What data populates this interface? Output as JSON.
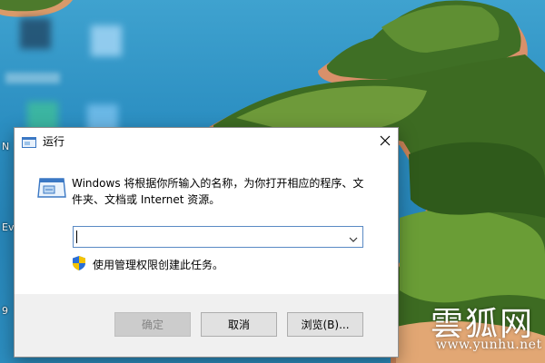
{
  "desktop": {
    "edge_labels": [
      "N",
      "Ev",
      "9"
    ],
    "watermark": {
      "chinese": "雲狐网",
      "url": "www.yunhu.net"
    }
  },
  "dialog": {
    "title": "运行",
    "description": "Windows 将根据你所输入的名称，为你打开相应的程序、文件夹、文档或 Internet 资源。",
    "open_field": {
      "value": "",
      "placeholder": ""
    },
    "admin_text": "使用管理权限创建此任务。",
    "buttons": {
      "ok": "确定",
      "cancel": "取消",
      "browse": "浏览(B)..."
    },
    "ok_enabled": false
  },
  "icons": {
    "title": "run-icon",
    "close": "close-icon",
    "big": "run-icon",
    "dropdown": "chevron-down-icon",
    "admin": "uac-shield-icon"
  },
  "colors": {
    "accent_border": "#5a8ac4",
    "footer_bg": "#f0f0f0",
    "button_bg": "#e1e1e1",
    "disabled_text": "#838383"
  }
}
